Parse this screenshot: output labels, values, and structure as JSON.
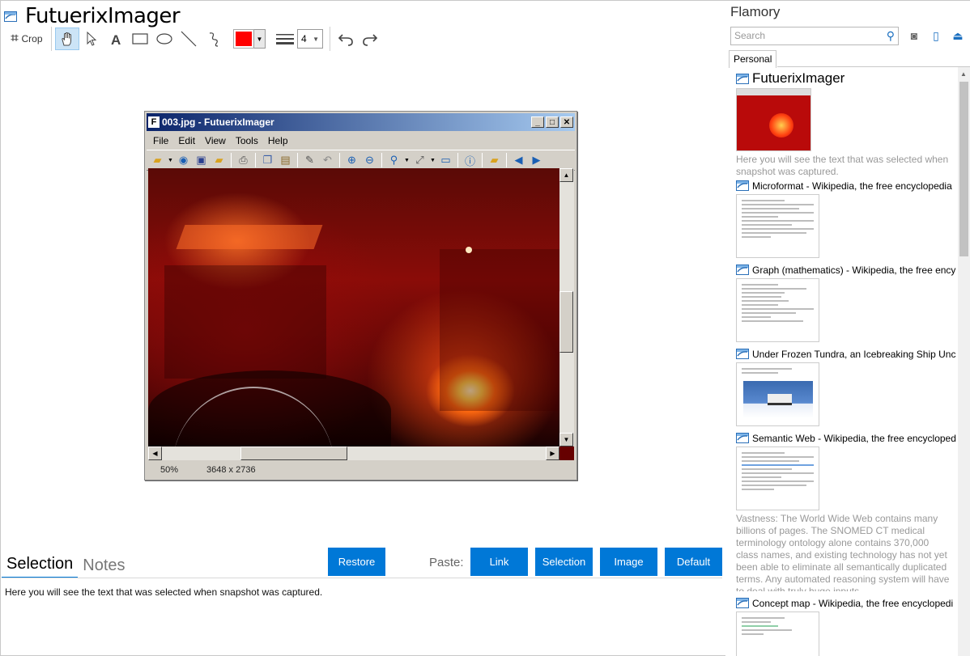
{
  "editor": {
    "title": "FutuerixImager",
    "crop_label": "Crop",
    "line_width": "4",
    "stroke_color": "#ff0000"
  },
  "screenshot": {
    "window_title": "003.jpg - FutuerixImager",
    "menu": [
      "File",
      "Edit",
      "View",
      "Tools",
      "Help"
    ],
    "zoom": "50%",
    "dimensions": "3648 x 2736"
  },
  "bottom_panel": {
    "tabs": [
      "Selection",
      "Notes"
    ],
    "restore_label": "Restore",
    "paste_label": "Paste:",
    "paste_buttons": [
      "Link",
      "Selection",
      "Image",
      "Default"
    ],
    "selection_text": "Here you will see the text that was selected when snapshot was captured."
  },
  "sidebar": {
    "title": "Flamory",
    "search_placeholder": "Search",
    "tab": "Personal",
    "entries": [
      {
        "title": "FutuerixImager",
        "desc": "Here you will see the text that was selected when snapshot was captured."
      },
      {
        "title": "Microformat - Wikipedia, the free encyclopedia"
      },
      {
        "title": "Graph (mathematics) - Wikipedia, the free ency"
      },
      {
        "title": "Under Frozen Tundra, an Icebreaking Ship Unco"
      },
      {
        "title": "Semantic Web - Wikipedia, the free encycloped",
        "desc": "Vastness: The World Wide Web contains many billions of pages. The SNOMED CT medical terminology ontology alone contains 370,000 class names, and existing technology has not yet been able to eliminate all semantically duplicated terms. Any automated reasoning system will have to deal with truly huge inputs."
      },
      {
        "title": "Concept map - Wikipedia, the free encyclopedi"
      }
    ]
  },
  "colors": {
    "accent": "#0078d7",
    "active_tool": "#cce4f7"
  }
}
